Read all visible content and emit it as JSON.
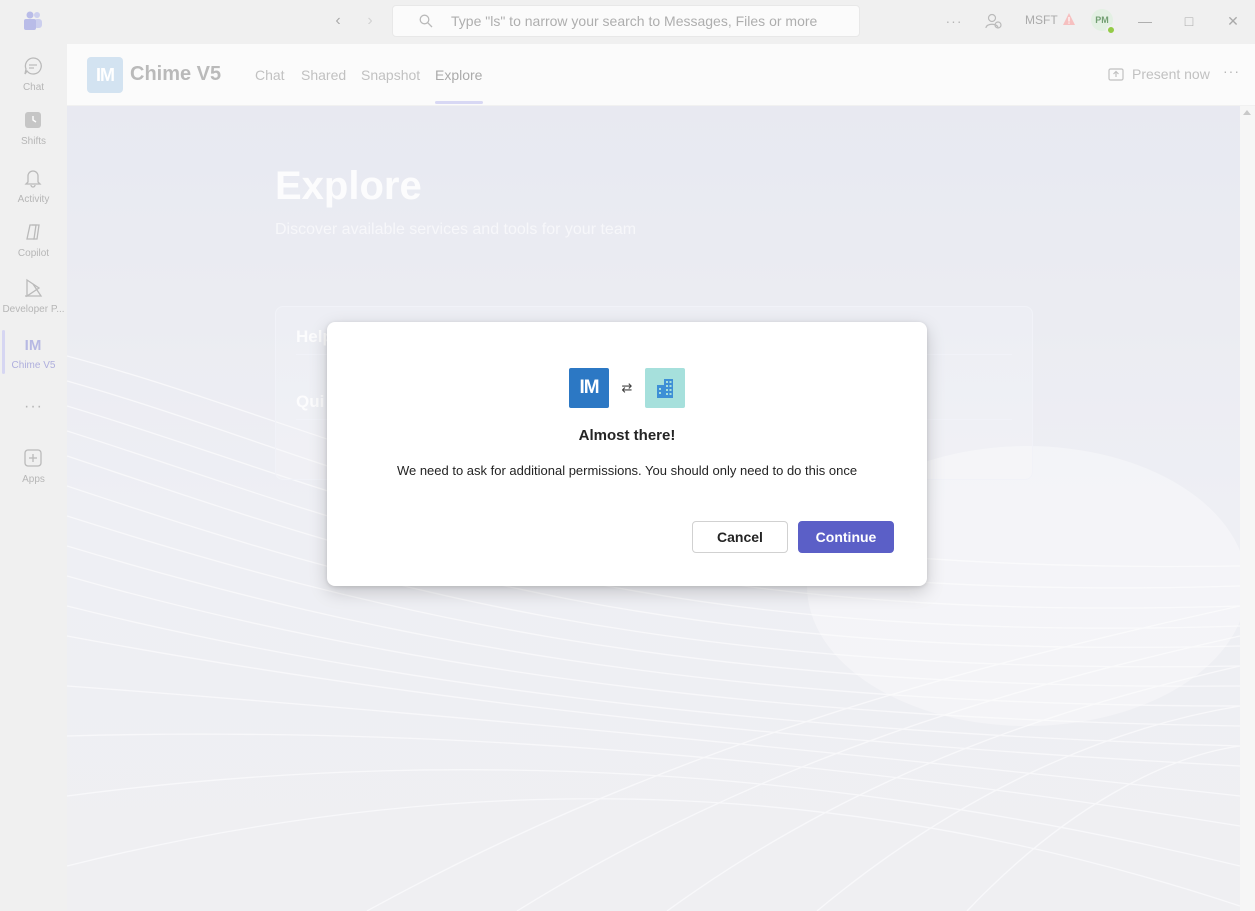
{
  "titlebar": {
    "search_placeholder": "Type \"ls\" to narrow your search to Messages, Files or more",
    "more": "···",
    "org": "MSFT",
    "avatar_initials": "PM",
    "window_buttons": [
      "minimize",
      "maximize",
      "close"
    ],
    "icons": {
      "logo": "teams-logo-icon",
      "back": "back-arrow-icon",
      "forward": "forward-arrow-icon",
      "search": "search-icon",
      "person": "people-icon",
      "warning": "warning-icon"
    }
  },
  "rail": {
    "items": [
      {
        "label": "Chat",
        "icon": "chat-icon"
      },
      {
        "label": "Shifts",
        "icon": "shifts-icon"
      },
      {
        "label": "Activity",
        "icon": "bell-icon"
      },
      {
        "label": "Copilot",
        "icon": "copilot-icon"
      },
      {
        "label": "Developer P...",
        "icon": "developer-portal-icon"
      },
      {
        "label": "Chime V5",
        "icon": "chime-icon",
        "active": true
      },
      {
        "label": "Apps",
        "icon": "apps-icon"
      }
    ],
    "more": "···"
  },
  "app_header": {
    "logo_text": "IM",
    "app_name": "Chime V5",
    "tabs": [
      {
        "label": "Chat"
      },
      {
        "label": "Shared"
      },
      {
        "label": "Snapshot"
      },
      {
        "label": "Explore",
        "active": true
      }
    ],
    "present_label": "Present now",
    "more": "···"
  },
  "content": {
    "title": "Explore",
    "subtitle": "Discover available services and tools for your team",
    "panel_rows": [
      "Help",
      "Qui"
    ]
  },
  "dialog": {
    "app_icon_text": "IM",
    "swap_symbol": "⇄",
    "title": "Almost there!",
    "message": "We need to ask for additional permissions. You should only need to do this once",
    "cancel_label": "Cancel",
    "continue_label": "Continue",
    "colors": {
      "primary": "#5b5fc7",
      "app_icon": "#2c78c4",
      "org_icon": "#a6e0dc"
    }
  }
}
